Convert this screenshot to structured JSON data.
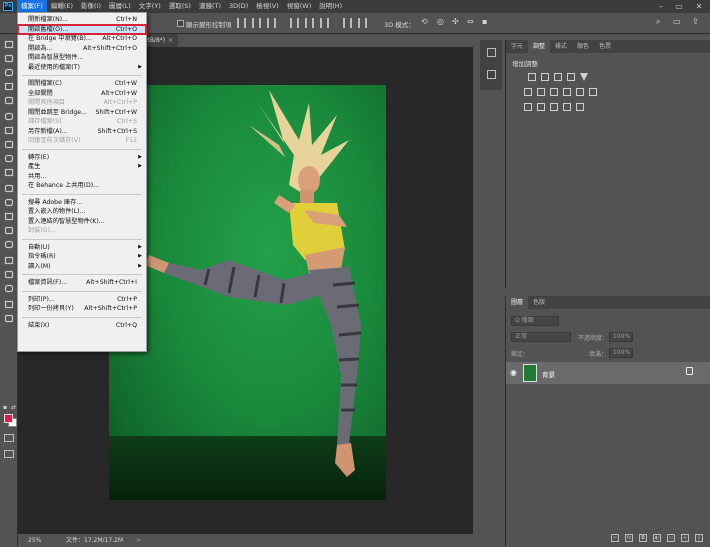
{
  "menubar": {
    "items": [
      "檔案(F)",
      "編輯(E)",
      "影像(I)",
      "圖層(L)",
      "文字(Y)",
      "選取(S)",
      "濾鏡(T)",
      "3D(D)",
      "檢視(V)",
      "視窗(W)",
      "說明(H)"
    ],
    "active_index": 0
  },
  "optionsbar": {
    "show_transform": "顯示變形控制項",
    "mode_3d": "3D 模式："
  },
  "document": {
    "tab_suffix": "3B/8*)",
    "close": "×",
    "zoom": "25%",
    "doc_info": "文件：17.2M/17.2M",
    "status_arrow": ">"
  },
  "file_menu": [
    {
      "label": "開新檔案(N)...",
      "shortcut": "Ctrl+N",
      "top": 0
    },
    {
      "label": "開啟舊檔(O)...",
      "shortcut": "Ctrl+O",
      "highlight": true
    },
    {
      "label": "在 Bridge 中瀏覽(B)...",
      "shortcut": "Alt+Ctrl+O"
    },
    {
      "label": "開啟為...",
      "shortcut": "Alt+Shift+Ctrl+O"
    },
    {
      "label": "開啟為智慧型物件..."
    },
    {
      "label": "最近使用的檔案(T)",
      "submenu": true
    },
    {
      "sep": true
    },
    {
      "label": "關閉檔案(C)",
      "shortcut": "Ctrl+W"
    },
    {
      "label": "全部關閉",
      "shortcut": "Alt+Ctrl+W"
    },
    {
      "label": "關閉其他項目",
      "shortcut": "Alt+Ctrl+P",
      "disabled": true
    },
    {
      "label": "關閉並跳至 Bridge...",
      "shortcut": "Shift+Ctrl+W"
    },
    {
      "label": "儲存檔案(S)",
      "shortcut": "Ctrl+S",
      "disabled": true
    },
    {
      "label": "另存新檔(A)...",
      "shortcut": "Shift+Ctrl+S"
    },
    {
      "label": "回復至前次儲存(V)",
      "shortcut": "F12",
      "disabled": true
    },
    {
      "sep": true
    },
    {
      "label": "轉存(E)",
      "submenu": true
    },
    {
      "label": "產生",
      "submenu": true
    },
    {
      "label": "共用..."
    },
    {
      "label": "在 Behance 上共用(D)..."
    },
    {
      "sep": true
    },
    {
      "label": "搜尋 Adobe 庫存..."
    },
    {
      "label": "置入嵌入的物件(L)..."
    },
    {
      "label": "置入連結的智慧型物件(K)..."
    },
    {
      "label": "封裝(G)...",
      "disabled": true
    },
    {
      "sep": true
    },
    {
      "label": "自動(U)",
      "submenu": true
    },
    {
      "label": "指令碼(R)",
      "submenu": true
    },
    {
      "label": "讀入(M)",
      "submenu": true
    },
    {
      "sep": true
    },
    {
      "label": "檔案資訊(F)...",
      "shortcut": "Alt+Shift+Ctrl+I"
    },
    {
      "sep": true
    },
    {
      "label": "列印(P)...",
      "shortcut": "Ctrl+P"
    },
    {
      "label": "列印一份拷貝(Y)",
      "shortcut": "Alt+Shift+Ctrl+P"
    },
    {
      "sep": true
    },
    {
      "label": "結束(X)",
      "shortcut": "Ctrl+Q"
    }
  ],
  "panels": {
    "top_tabs": [
      "字元",
      "調整",
      "樣式",
      "顏色",
      "色票"
    ],
    "top_active": 1,
    "adjustments_title": "增加調整",
    "layer_tabs": [
      "圖層",
      "色版"
    ],
    "layer_active": 0,
    "kind_filter": "Q 種類",
    "blend_mode": "正常",
    "opacity_label": "不透明度：",
    "opacity_value": "100%",
    "lock_label": "鎖定：",
    "fill_label": "填滿：",
    "fill_value": "100%",
    "layer_name": "背景"
  },
  "colors": {
    "foreground": "#e8174d",
    "background": "#ffffff",
    "accent_highlight": "#d8243a"
  },
  "icons": [
    "move-icon",
    "marquee-icon",
    "lasso-icon",
    "quick-select-icon",
    "crop-icon",
    "eyedropper-icon",
    "healing-icon",
    "brush-icon",
    "stamp-icon",
    "history-brush-icon",
    "eraser-icon",
    "gradient-icon",
    "blur-icon",
    "dodge-icon",
    "pen-icon",
    "type-icon",
    "path-select-icon",
    "shape-icon",
    "hand-icon",
    "zoom-icon"
  ]
}
